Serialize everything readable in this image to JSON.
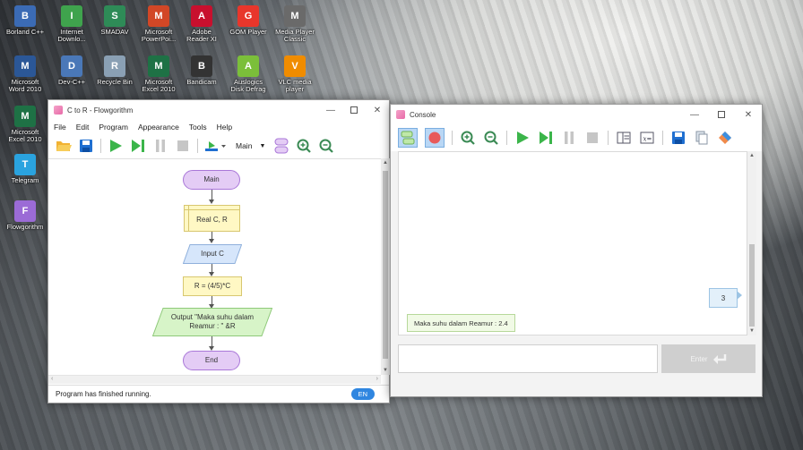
{
  "desktop_icons": [
    {
      "label": "Borland C++",
      "icon": "borland-icon",
      "color": "#3b6bb5"
    },
    {
      "label": "Internet Downlo...",
      "icon": "idm-icon",
      "color": "#3fa34d"
    },
    {
      "label": "SMADAV",
      "icon": "smadav-icon",
      "color": "#2e8b57"
    },
    {
      "label": "Microsoft PowerPoi...",
      "icon": "powerpoint-icon",
      "color": "#d24726"
    },
    {
      "label": "Adobe Reader XI",
      "icon": "adobe-reader-icon",
      "color": "#c8102e"
    },
    {
      "label": "GOM Player",
      "icon": "gom-player-icon",
      "color": "#e8362b"
    },
    {
      "label": "Media Player Classic",
      "icon": "mpc-icon",
      "color": "#6a6a6a"
    },
    {
      "label": "Microsoft Word 2010",
      "icon": "word-icon",
      "color": "#2b5797"
    },
    {
      "label": "Dev-C++",
      "icon": "devcpp-icon",
      "color": "#4a78b8"
    },
    {
      "label": "Recycle Bin",
      "icon": "recycle-bin-icon",
      "color": "#8aa0b4"
    },
    {
      "label": "Microsoft Excel 2010",
      "icon": "excel-icon",
      "color": "#1e7145"
    },
    {
      "label": "Bandicam",
      "icon": "bandicam-icon",
      "color": "#333333"
    },
    {
      "label": "Auslogics Disk Defrag",
      "icon": "auslogics-icon",
      "color": "#7bbf3a"
    },
    {
      "label": "VLC media player",
      "icon": "vlc-icon",
      "color": "#f08c00"
    },
    {
      "label": "Microsoft Excel 2010",
      "icon": "excel-icon",
      "color": "#1e7145"
    },
    {
      "label": "Telegram",
      "icon": "telegram-icon",
      "color": "#2aa3df"
    },
    {
      "label": "Flowgorithm",
      "icon": "flowgorithm-icon",
      "color": "#9b6bd6"
    }
  ],
  "flowgorithm": {
    "title": "C to R - Flowgorithm",
    "menu": [
      "File",
      "Edit",
      "Program",
      "Appearance",
      "Tools",
      "Help"
    ],
    "function_select": "Main",
    "shapes": {
      "start": "Main",
      "declare": "Real C, R",
      "input": "Input C",
      "assign": "R = (4/5)*C",
      "output_line1": "Output \"Maka suhu dalam",
      "output_line2": "Reamur : \" &R",
      "end": "End"
    },
    "status": "Program has finished running.",
    "language_badge": "EN"
  },
  "console": {
    "title": "Console",
    "user_input": "3",
    "output": "Maka suhu dalam Reamur : 2.4",
    "input_placeholder": "",
    "enter_label": "Enter"
  },
  "colors": {
    "start_end_fill": "#e4ccf5",
    "start_end_stroke": "#a977d8",
    "declare_fill": "#fff8c4",
    "declare_stroke": "#d8c770",
    "io_fill": "#d6e6fb",
    "io_stroke": "#8fb0dc",
    "output_fill": "#d7f4c8",
    "output_stroke": "#8fc97a",
    "run_green": "#3bb54a",
    "lang_badge": "#2f86e0"
  }
}
